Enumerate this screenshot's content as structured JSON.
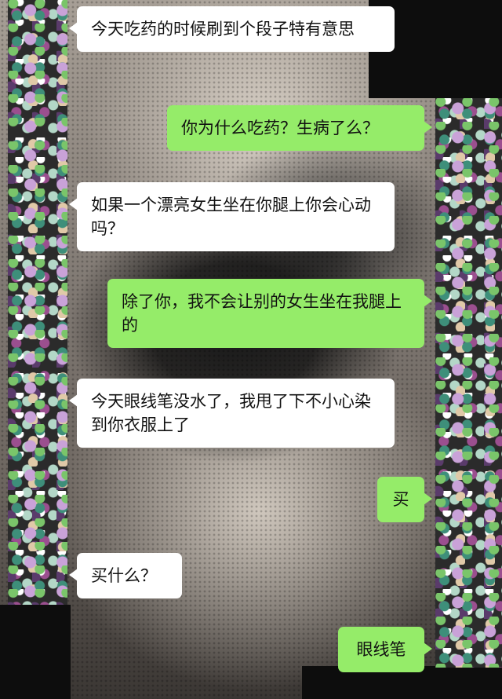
{
  "colors": {
    "incoming_bubble": "#ffffff",
    "outgoing_bubble": "#95ec69",
    "text": "#111111"
  },
  "messages": [
    {
      "sender": "other",
      "text": "今天吃药的时候刷到个段子特有意思"
    },
    {
      "sender": "self",
      "text": "你为什么吃药？生病了么？"
    },
    {
      "sender": "other",
      "text": "如果一个漂亮女生坐在你腿上你会心动吗？"
    },
    {
      "sender": "self",
      "text": "除了你，我不会让别的女生坐在我腿上的"
    },
    {
      "sender": "other",
      "text": "今天眼线笔没水了，我甩了下不小心染到你衣服上了"
    },
    {
      "sender": "self",
      "text": "买"
    },
    {
      "sender": "other",
      "text": "买什么？"
    },
    {
      "sender": "self",
      "text": "眼线笔"
    }
  ]
}
